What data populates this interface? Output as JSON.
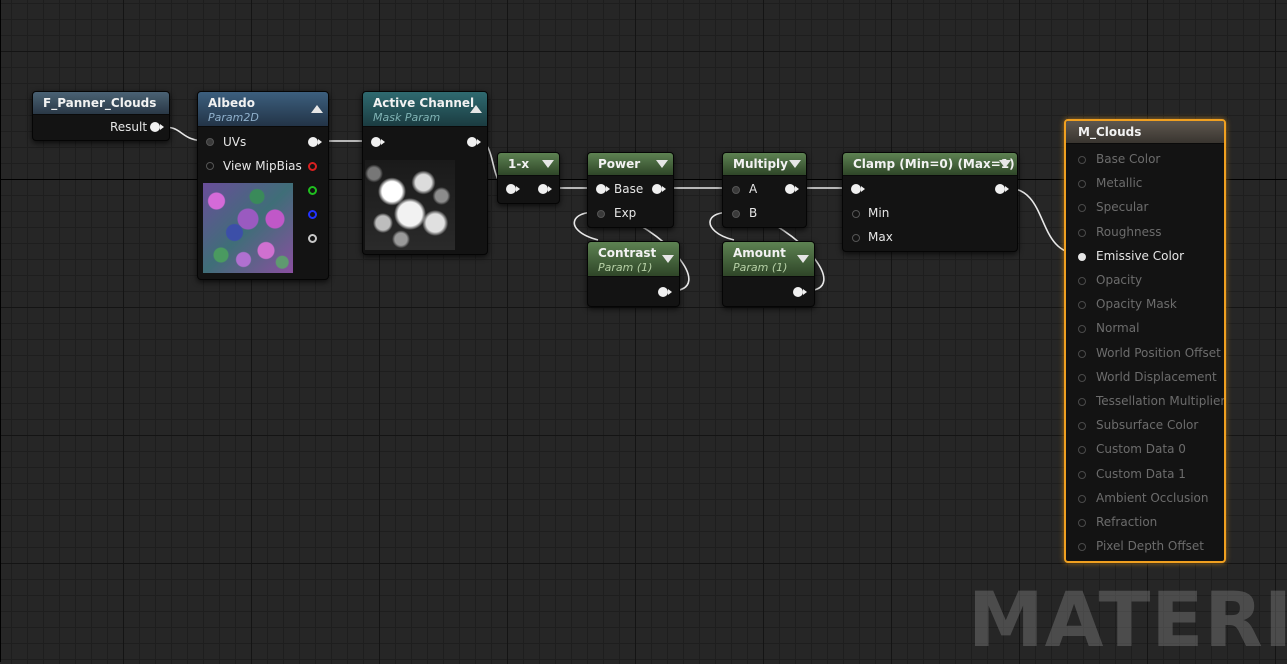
{
  "graph": {
    "watermark": "MATERIAL"
  },
  "nodes": {
    "panner": {
      "title": "F_Panner_Clouds",
      "outputs": [
        "Result"
      ]
    },
    "albedo": {
      "title": "Albedo",
      "subtitle": "Param2D",
      "inputs": [
        "UVs",
        "View MipBias"
      ]
    },
    "active_channel": {
      "title": "Active Channel",
      "subtitle": "Mask Param"
    },
    "one_minus": {
      "title": "1-x"
    },
    "power": {
      "title": "Power",
      "inputs": [
        "Base",
        "Exp"
      ]
    },
    "contrast": {
      "title": "Contrast",
      "subtitle": "Param (1)"
    },
    "multiply": {
      "title": "Multiply",
      "inputs": [
        "A",
        "B"
      ]
    },
    "amount": {
      "title": "Amount",
      "subtitle": "Param (1)"
    },
    "clamp": {
      "title": "Clamp (Min=0) (Max=1)",
      "inputs": [
        "Min",
        "Max"
      ]
    },
    "result": {
      "title": "M_Clouds",
      "inputs": [
        "Base Color",
        "Metallic",
        "Specular",
        "Roughness",
        "Emissive Color",
        "Opacity",
        "Opacity Mask",
        "Normal",
        "World Position Offset",
        "World Displacement",
        "Tessellation Multiplier",
        "Subsurface Color",
        "Custom Data 0",
        "Custom Data 1",
        "Ambient Occlusion",
        "Refraction",
        "Pixel Depth Offset"
      ],
      "active_input": "Emissive Color"
    }
  },
  "colors": {
    "selected_border": "#f0a020",
    "pin_red": "#d92020",
    "pin_green": "#1fbf1f",
    "pin_blue": "#2233ff"
  }
}
